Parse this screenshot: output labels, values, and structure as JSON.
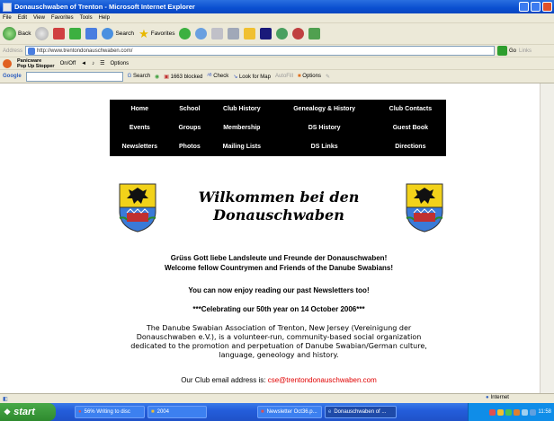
{
  "window": {
    "title": "Donauschwaben of Trenton - Microsoft Internet Explorer"
  },
  "menu": [
    "File",
    "Edit",
    "View",
    "Favorites",
    "Tools",
    "Help"
  ],
  "toolbar": {
    "back": "Back",
    "search": "Search",
    "favorites": "Favorites"
  },
  "address": {
    "label": "Address",
    "url": "http://www.trentondonauschwaben.com/",
    "go": "Go",
    "links": "Links"
  },
  "popupbar": {
    "logo_line1": "Panicware",
    "logo_line2": "Pop Up Stopper",
    "onoff": "On/Off",
    "options": "Options"
  },
  "googlebar": {
    "label": "Google",
    "search": "Search",
    "blocked": "1663 blocked",
    "check": "Check",
    "lookfor": "Look for Map",
    "autofill": "AutoFill",
    "options": "Options"
  },
  "nav": {
    "rows": [
      [
        "Home",
        "School",
        "Club History",
        "Genealogy & History",
        "Club Contacts"
      ],
      [
        "Events",
        "Groups",
        "Membership",
        "DS History",
        "Guest Book"
      ],
      [
        "Newsletters",
        "Photos",
        "Mailing Lists",
        "DS Links",
        "Directions"
      ]
    ]
  },
  "content": {
    "heading_line1": "Wilkommen bei den",
    "heading_line2": "Donauschwaben",
    "greeting_de": "Grüss Gott liebe Landsleute und Freunde der Donauschwaben!",
    "greeting_en": "Welcome fellow Countrymen and Friends of the Danube Swabians!",
    "newsletters": "You can now enjoy reading our past Newsletters too!",
    "celebrating": "***Celebrating our 50th year on 14 October 2006***",
    "description": "The Danube Swabian Association of Trenton, New Jersey (Vereinigung der Donauschwaben e.V.), is a volunteer-run, community-based social organization dedicated to the promotion and perpetuation of Danube Swabian/German culture, language, geneology and history.",
    "email_label": "Our Club email address is: ",
    "email": "cse@trentondonauschwaben.com"
  },
  "status": {
    "zone": "Internet"
  },
  "taskbar": {
    "start": "start",
    "tasks": [
      "56% Writing to disc",
      "2004",
      "Newsletter Oct36.p...",
      "Donauschwaben of ..."
    ],
    "time": "11:58"
  }
}
